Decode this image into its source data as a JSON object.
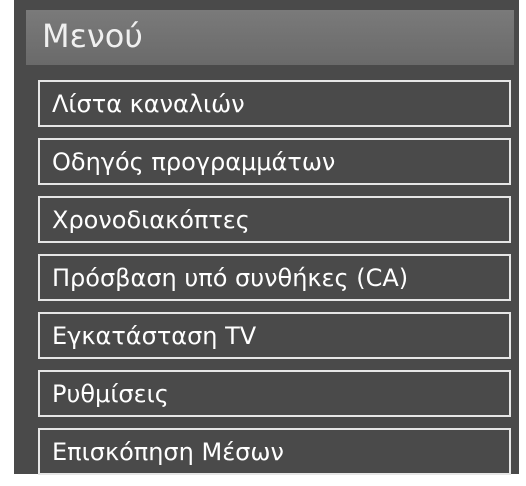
{
  "menu": {
    "title": "Μενού",
    "items": [
      {
        "label": "Λίστα καναλιών"
      },
      {
        "label": "Οδηγός προγραμμάτων"
      },
      {
        "label": "Χρονοδιακόπτες"
      },
      {
        "label": "Πρόσβαση υπό συνθήκες (CA)"
      },
      {
        "label": "Εγκατάσταση TV"
      },
      {
        "label": "Ρυθμίσεις"
      },
      {
        "label": "Επισκόπηση Μέσων"
      }
    ]
  },
  "colors": {
    "panel_background": "#4a4a4a",
    "header_background": "#727272",
    "item_border": "#e6e6e6",
    "text": "#ffffff"
  }
}
